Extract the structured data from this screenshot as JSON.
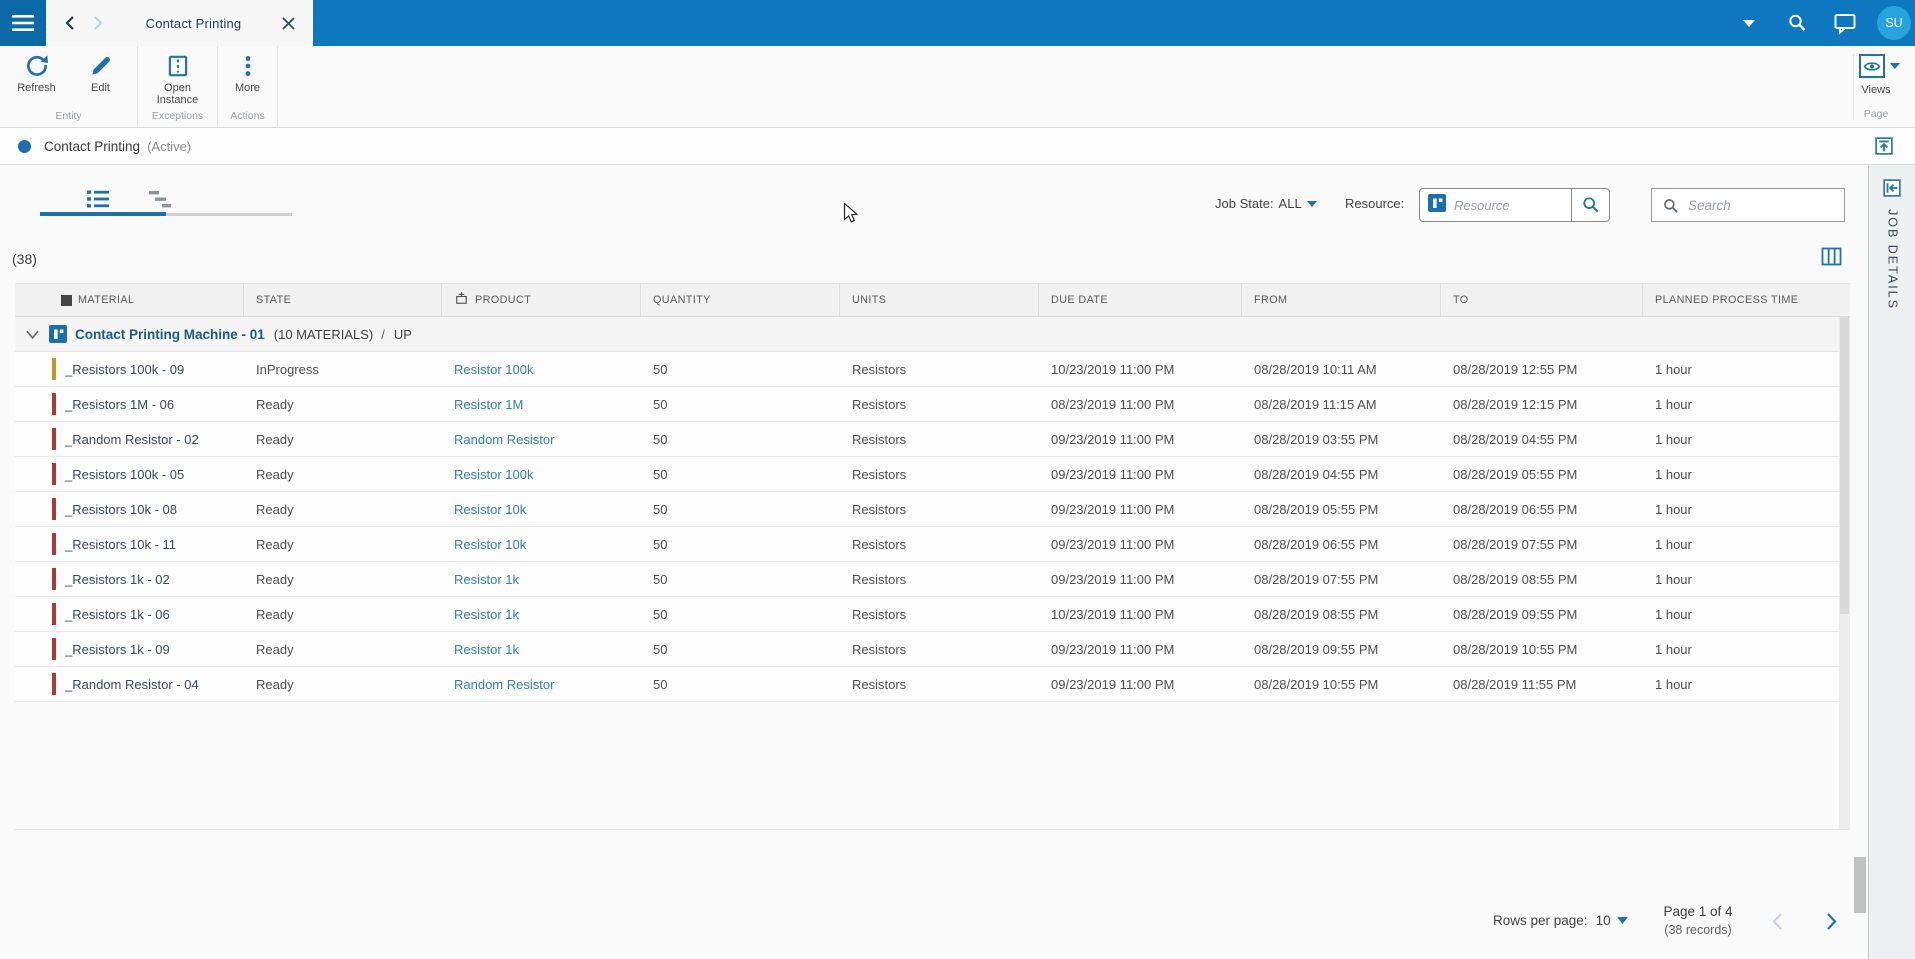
{
  "topbar": {
    "tab_title": "Contact Printing",
    "avatar_initials": "SU"
  },
  "ribbon": {
    "groups": [
      {
        "label": "Entity",
        "buttons": [
          {
            "label": "Refresh",
            "icon": "refresh-icon"
          },
          {
            "label": "Edit",
            "icon": "edit-icon"
          }
        ]
      },
      {
        "label": "Exceptions",
        "buttons": [
          {
            "label": "Open Instance",
            "icon": "open-instance-icon"
          }
        ]
      },
      {
        "label": "Actions",
        "buttons": [
          {
            "label": "More",
            "icon": "more-icon"
          }
        ]
      }
    ],
    "views_label": "Views",
    "page_group_label": "Page"
  },
  "status": {
    "title": "Contact Printing",
    "state": "(Active)"
  },
  "filters": {
    "job_state_label": "Job State:",
    "job_state_value": "ALL",
    "resource_label": "Resource:",
    "resource_placeholder": "Resource",
    "search_placeholder": "Search"
  },
  "grid": {
    "record_count": "(38)",
    "columns": [
      {
        "label": "MATERIAL",
        "icon": "material-icon"
      },
      {
        "label": "STATE"
      },
      {
        "label": "PRODUCT",
        "icon": "product-icon"
      },
      {
        "label": "QUANTITY"
      },
      {
        "label": "UNITS"
      },
      {
        "label": "DUE DATE"
      },
      {
        "label": "FROM"
      },
      {
        "label": "TO"
      },
      {
        "label": "PLANNED PROCESS TIME"
      }
    ],
    "group_row": {
      "name": "Contact Printing Machine - 01",
      "materials_count": "(10 MATERIALS)",
      "separator": "/",
      "status": "UP"
    },
    "rows": [
      {
        "material": "_Resistors 100k - 09",
        "state": "InProgress",
        "product": "Resistor 100k",
        "quantity": "50",
        "units": "Resistors",
        "due_date": "10/23/2019 11:00 PM",
        "from": "08/28/2019 10:11 AM",
        "to": "08/28/2019 12:55 PM",
        "planned_process_time": "1 hour",
        "indicator_color": "#c6952c"
      },
      {
        "material": "_Resistors 1M - 06",
        "state": "Ready",
        "product": "Resistor 1M",
        "quantity": "50",
        "units": "Resistors",
        "due_date": "08/23/2019 11:00 PM",
        "from": "08/28/2019 11:15 AM",
        "to": "08/28/2019 12:15 PM",
        "planned_process_time": "1 hour",
        "indicator_color": "#a93b32"
      },
      {
        "material": "_Random Resistor - 02",
        "state": "Ready",
        "product": "Random Resistor",
        "quantity": "50",
        "units": "Resistors",
        "due_date": "09/23/2019 11:00 PM",
        "from": "08/28/2019 03:55 PM",
        "to": "08/28/2019 04:55 PM",
        "planned_process_time": "1 hour",
        "indicator_color": "#a93b32"
      },
      {
        "material": "_Resistors 100k - 05",
        "state": "Ready",
        "product": "Resistor 100k",
        "quantity": "50",
        "units": "Resistors",
        "due_date": "09/23/2019 11:00 PM",
        "from": "08/28/2019 04:55 PM",
        "to": "08/28/2019 05:55 PM",
        "planned_process_time": "1 hour",
        "indicator_color": "#a93b32"
      },
      {
        "material": "_Resistors 10k - 08",
        "state": "Ready",
        "product": "Resistor 10k",
        "quantity": "50",
        "units": "Resistors",
        "due_date": "09/23/2019 11:00 PM",
        "from": "08/28/2019 05:55 PM",
        "to": "08/28/2019 06:55 PM",
        "planned_process_time": "1 hour",
        "indicator_color": "#a93b32"
      },
      {
        "material": "_Resistors 10k - 11",
        "state": "Ready",
        "product": "Resistor 10k",
        "quantity": "50",
        "units": "Resistors",
        "due_date": "09/23/2019 11:00 PM",
        "from": "08/28/2019 06:55 PM",
        "to": "08/28/2019 07:55 PM",
        "planned_process_time": "1 hour",
        "indicator_color": "#a93b32"
      },
      {
        "material": "_Resistors 1k - 02",
        "state": "Ready",
        "product": "Resistor 1k",
        "quantity": "50",
        "units": "Resistors",
        "due_date": "09/23/2019 11:00 PM",
        "from": "08/28/2019 07:55 PM",
        "to": "08/28/2019 08:55 PM",
        "planned_process_time": "1 hour",
        "indicator_color": "#a93b32"
      },
      {
        "material": "_Resistors 1k - 06",
        "state": "Ready",
        "product": "Resistor 1k",
        "quantity": "50",
        "units": "Resistors",
        "due_date": "10/23/2019 11:00 PM",
        "from": "08/28/2019 08:55 PM",
        "to": "08/28/2019 09:55 PM",
        "planned_process_time": "1 hour",
        "indicator_color": "#a93b32"
      },
      {
        "material": "_Resistors 1k - 09",
        "state": "Ready",
        "product": "Resistor 1k",
        "quantity": "50",
        "units": "Resistors",
        "due_date": "09/23/2019 11:00 PM",
        "from": "08/28/2019 09:55 PM",
        "to": "08/28/2019 10:55 PM",
        "planned_process_time": "1 hour",
        "indicator_color": "#a93b32"
      },
      {
        "material": "_Random Resistor - 04",
        "state": "Ready",
        "product": "Random Resistor",
        "quantity": "50",
        "units": "Resistors",
        "due_date": "09/23/2019 11:00 PM",
        "from": "08/28/2019 10:55 PM",
        "to": "08/28/2019 11:55 PM",
        "planned_process_time": "1 hour",
        "indicator_color": "#a93b32"
      }
    ]
  },
  "pagination": {
    "rows_per_page_label": "Rows per page:",
    "rows_per_page_value": "10",
    "page_info": "Page 1 of 4",
    "records_info": "(38 records)"
  },
  "side_panel": {
    "title": "JOB DETAILS"
  },
  "colors": {
    "topbar_blue": "#0d78bf",
    "topbar_dark_blue": "#0b69a7",
    "accent_blue": "#2272a7",
    "link_blue": "#3481ad",
    "group_title_blue": "#1c5a87",
    "avatar_blue": "#29a3dd",
    "indicator_amber": "#c6952c",
    "indicator_red": "#a93b32"
  }
}
